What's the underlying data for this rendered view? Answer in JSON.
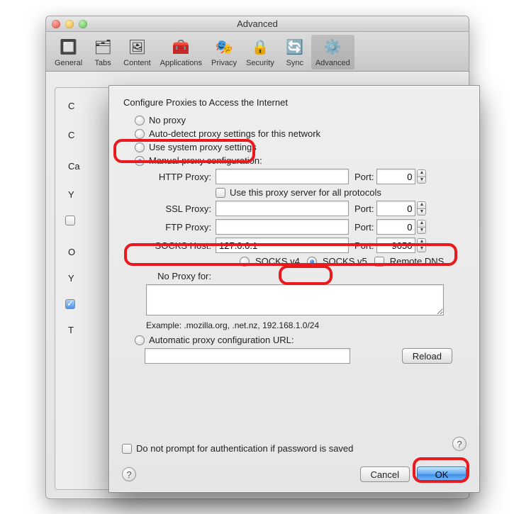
{
  "window": {
    "title": "Advanced"
  },
  "toolbar": {
    "items": [
      {
        "label": "General",
        "icon": "🔲"
      },
      {
        "label": "Tabs",
        "icon": "🗂"
      },
      {
        "label": "Content",
        "icon": "🖼"
      },
      {
        "label": "Applications",
        "icon": "🧰"
      },
      {
        "label": "Privacy",
        "icon": "🎭"
      },
      {
        "label": "Security",
        "icon": "🔒"
      },
      {
        "label": "Sync",
        "icon": "🔄"
      },
      {
        "label": "Advanced",
        "icon": "⚙️",
        "selected": true
      }
    ]
  },
  "background_labels": {
    "c1": "C",
    "c2": "C",
    "ca": "Ca",
    "y1": "Y",
    "o": "O",
    "y2": "Y",
    "t": "T"
  },
  "sheet": {
    "heading": "Configure Proxies to Access the Internet",
    "options": {
      "no_proxy": "No proxy",
      "auto_detect": "Auto-detect proxy settings for this network",
      "system": "Use system proxy settings",
      "manual": "Manual proxy configuration:",
      "auto_url": "Automatic proxy configuration URL:"
    },
    "fields": {
      "http_label": "HTTP Proxy:",
      "ssl_label": "SSL Proxy:",
      "ftp_label": "FTP Proxy:",
      "socks_label": "SOCKS Host:",
      "port_label": "Port:",
      "http_value": "",
      "http_port": "0",
      "ssl_value": "",
      "ssl_port": "0",
      "ftp_value": "",
      "ftp_port": "0",
      "socks_value": "127.0.0.1",
      "socks_port": "9050",
      "use_for_all": "Use this proxy server for all protocols",
      "socks_v4": "SOCKS v4",
      "socks_v5": "SOCKS v5",
      "remote_dns": "Remote DNS",
      "no_proxy_for_label": "No Proxy for:",
      "no_proxy_for_value": "",
      "example": "Example: .mozilla.org, .net.nz, 192.168.1.0/24",
      "pac_value": "",
      "reload": "Reload"
    },
    "checkline": "Do not prompt for authentication if password is saved",
    "buttons": {
      "cancel": "Cancel",
      "ok": "OK"
    }
  }
}
